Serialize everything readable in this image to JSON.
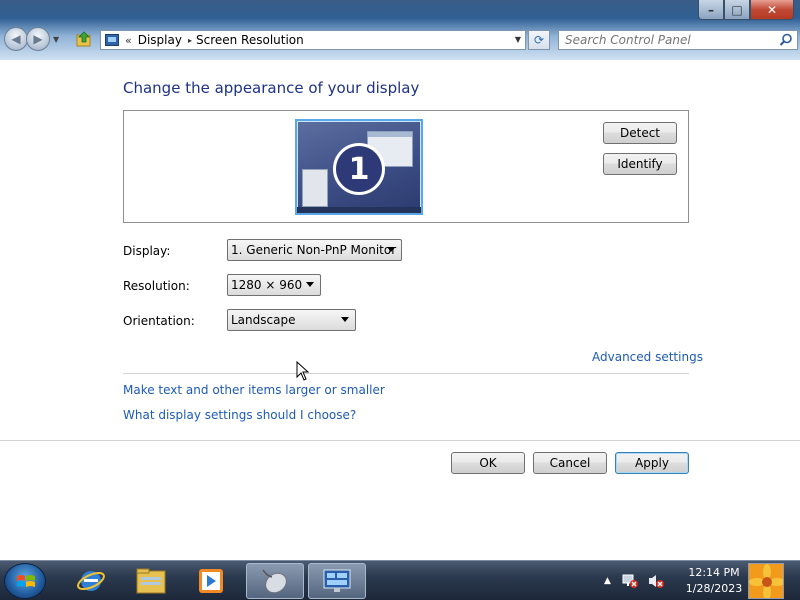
{
  "window": {
    "minimize_glyph": "–",
    "maximize_glyph": "□",
    "close_glyph": "✕"
  },
  "address_bar": {
    "overflow": "«",
    "breadcrumbs": [
      "Display",
      "Screen Resolution"
    ],
    "separator": "▸"
  },
  "search": {
    "placeholder": "Search Control Panel"
  },
  "main": {
    "heading": "Change the appearance of your display",
    "monitor_number": "1",
    "detect_label": "Detect",
    "identify_label": "Identify",
    "display_label": "Display:",
    "display_value": "1. Generic Non-PnP Monitor",
    "resolution_label": "Resolution:",
    "resolution_value": "1280 × 960",
    "orientation_label": "Orientation:",
    "orientation_value": "Landscape",
    "advanced_link": "Advanced settings",
    "larger_link": "Make text and other items larger or smaller",
    "help_link": "What display settings should I choose?"
  },
  "footer": {
    "ok_label": "OK",
    "cancel_label": "Cancel",
    "apply_label": "Apply"
  },
  "taskbar": {
    "items": [
      "internet-explorer-icon",
      "windows-explorer-icon",
      "media-player-icon",
      "mouse-icon",
      "display-settings-icon"
    ],
    "clock_time": "12:14 PM",
    "clock_date": "1/28/2023"
  },
  "colors": {
    "link": "#1e5bb5",
    "heading": "#1e3287",
    "taskbar": "#2c3a4f"
  }
}
